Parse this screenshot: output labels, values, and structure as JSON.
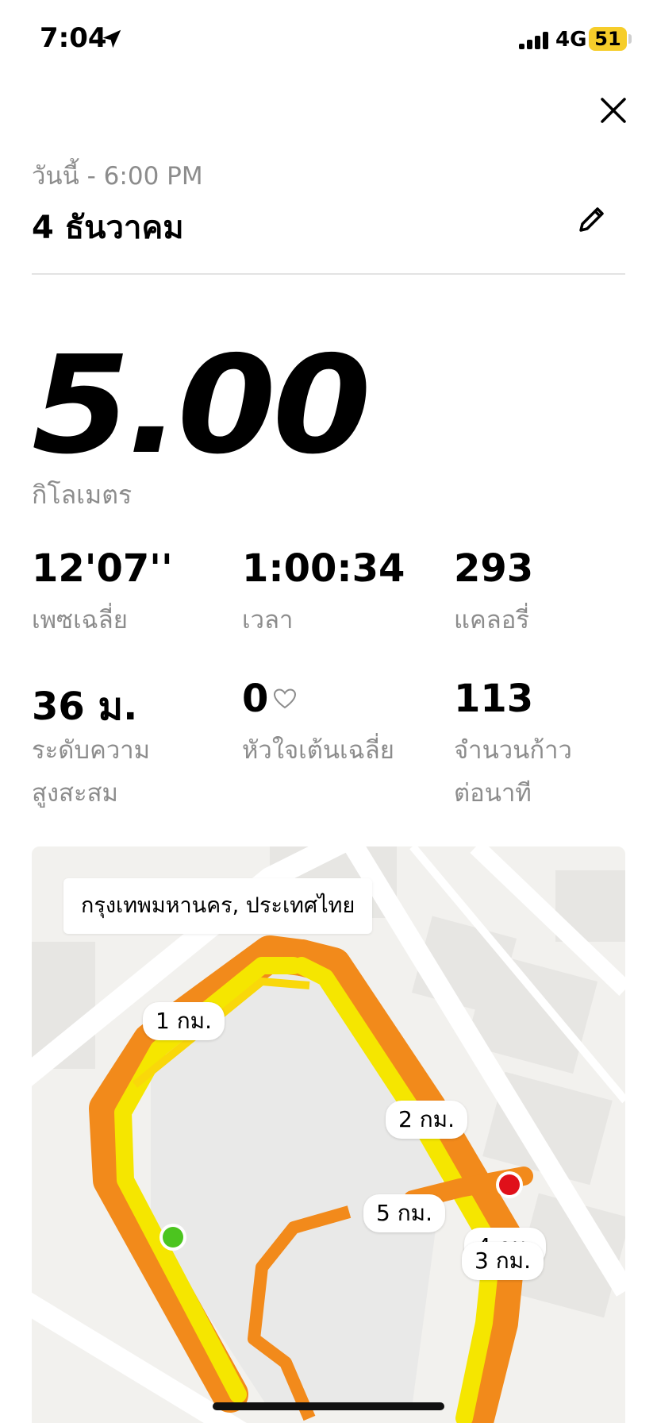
{
  "status": {
    "time": "7:04",
    "network": "4G",
    "battery": "51"
  },
  "icons": {
    "location": "location-arrow-icon",
    "signal": "signal-bars-icon",
    "close": "close-icon",
    "edit": "pencil-icon",
    "heart": "heart-icon"
  },
  "header": {
    "subtitle": "วันนี้ - 6:00 PM",
    "title": "4 ธันวาคม"
  },
  "summary": {
    "distance": "5.00",
    "unit": "กิโลเมตร"
  },
  "stats": [
    {
      "value": "12'07''",
      "label": "เพซเฉลี่ย"
    },
    {
      "value": "1:00:34",
      "label": "เวลา"
    },
    {
      "value": "293",
      "label": "แคลอรี่"
    },
    {
      "value": "36 ม.",
      "label": "ระดับความ",
      "label2": "สูงสะสม"
    },
    {
      "value": "0",
      "label": "หัวใจเต้นเฉลี่ย"
    },
    {
      "value": "113",
      "label": "จำนวนก้าว",
      "label2": "ต่อนาที"
    }
  ],
  "map": {
    "place": "กรุงเทพมหานคร, ประเทศไทย",
    "markers": [
      "1 กม.",
      "2 กม.",
      "5 กม.",
      "4 กม.",
      "3 กม."
    ],
    "colors": {
      "start": "#4cc51f",
      "end": "#e0101a",
      "route_yellow": "#f5e600",
      "route_orange": "#f28a1b"
    }
  }
}
